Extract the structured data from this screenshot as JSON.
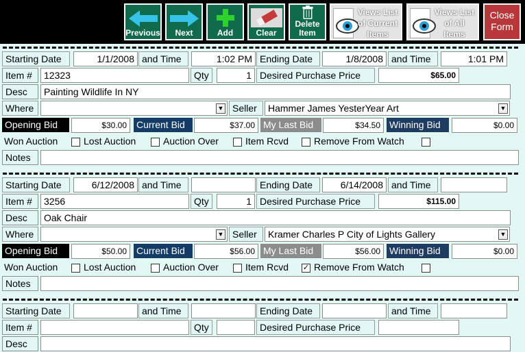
{
  "toolbar": {
    "previous": "Previous",
    "next": "Next",
    "add": "Add",
    "clear": "Clear",
    "delete_line1": "Delete",
    "delete_line2": "Item",
    "views_current": [
      "Views List",
      "of Current",
      "Items"
    ],
    "views_all": [
      "Views List",
      "of All",
      "Items"
    ],
    "close_line1": "Close",
    "close_line2": "Form"
  },
  "labels": {
    "starting_date": "Starting Date",
    "and_time": "and Time",
    "ending_date": "Ending Date",
    "item_no": "Item #",
    "qty": "Qty",
    "desired_price": "Desired Purchase Price",
    "desc": "Desc",
    "where": "Where",
    "seller": "Seller",
    "opening_bid": "Opening Bid",
    "current_bid": "Current Bid",
    "my_last_bid": "My Last Bid",
    "winning_bid": "Winning Bid",
    "won_auction": "Won Auction",
    "lost_auction": "Lost Auction",
    "auction_over": "Auction Over",
    "item_rcvd": "Item Rcvd",
    "remove_watch": "Remove From Watch",
    "notes": "Notes"
  },
  "records": [
    {
      "start_date": "1/1/2008",
      "start_time": "1:02 PM",
      "end_date": "1/8/2008",
      "end_time": "1:01 PM",
      "item_no": "12323",
      "qty": "1",
      "desired_price": "$65.00",
      "desc": "Painting Wildlife In NY",
      "where": "",
      "seller": "Hammer James    YesterYear Art",
      "opening_bid": "$30.00",
      "current_bid": "$37.00",
      "my_last_bid": "$34.50",
      "winning_bid": "$0.00",
      "won_auction": false,
      "lost_auction": false,
      "auction_over": false,
      "item_rcvd": false,
      "remove_watch": false,
      "notes": ""
    },
    {
      "start_date": "6/12/2008",
      "start_time": "",
      "end_date": "6/14/2008",
      "end_time": "",
      "item_no": "3256",
      "qty": "1",
      "desired_price": "$115.00",
      "desc": "Oak Chair",
      "where": "",
      "seller": "Kramer Charles P   City of Lights Gallery",
      "opening_bid": "$50.00",
      "current_bid": "$56.00",
      "my_last_bid": "$56.00",
      "winning_bid": "$0.00",
      "won_auction": false,
      "lost_auction": false,
      "auction_over": false,
      "item_rcvd": true,
      "remove_watch": false,
      "notes": ""
    },
    {
      "start_date": "",
      "start_time": "",
      "end_date": "",
      "end_time": "",
      "item_no": "",
      "qty": "",
      "desired_price": "",
      "desc": ""
    }
  ],
  "colors": {
    "background": "#e3f8f3",
    "toolbar": "#000000",
    "button_green": "#0f6b4b",
    "close_red": "#b8373a",
    "arrow_cyan": "#35c4e8",
    "plus_green": "#2fd12f"
  }
}
